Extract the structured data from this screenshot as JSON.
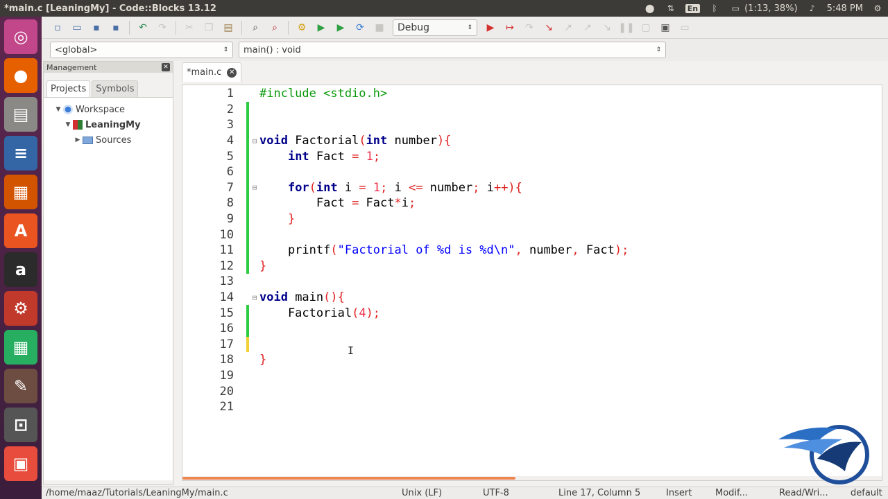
{
  "window": {
    "title": "*main.c [LeaningMy] - Code::Blocks 13.12"
  },
  "tray": {
    "lang": "En",
    "battery": "(1:13, 38%)",
    "clock": "5:48 PM"
  },
  "toolbar": {
    "build_target": "Debug"
  },
  "scope": {
    "global": "<global>",
    "function": "main() : void"
  },
  "management": {
    "title": "Management",
    "tabs": [
      "Projects",
      "Symbols"
    ],
    "tree": {
      "workspace": "Workspace",
      "project": "LeaningMy",
      "sources": "Sources"
    }
  },
  "editor": {
    "tab_label": "*main.c",
    "line_numbers": [
      "1",
      "2",
      "3",
      "4",
      "5",
      "6",
      "7",
      "8",
      "9",
      "10",
      "11",
      "12",
      "13",
      "14",
      "15",
      "16",
      "17",
      "18",
      "19",
      "20",
      "21"
    ]
  },
  "status": {
    "path": "/home/maaz/Tutorials/LeaningMy/main.c",
    "eol": "Unix (LF)",
    "encoding": "UTF-8",
    "position": "Line 17, Column 5",
    "mode": "Insert",
    "modified": "Modif...",
    "access": "Read/Wri...",
    "profile": "default"
  },
  "colors": {
    "keyword": "#00008b",
    "preprocessor": "#0a9a0a",
    "string": "#0000ff",
    "number": "#f0304a",
    "change_saved": "#2ecc40",
    "change_unsaved": "#f5d033"
  },
  "icons": [
    "ubuntu-logo-icon",
    "firefox-icon",
    "files-icon",
    "writer-icon",
    "impress-icon",
    "software-center-icon",
    "amazon-icon",
    "settings-icon",
    "calc-icon",
    "gimp-icon",
    "lock-icon",
    "codeblocks-icon"
  ]
}
